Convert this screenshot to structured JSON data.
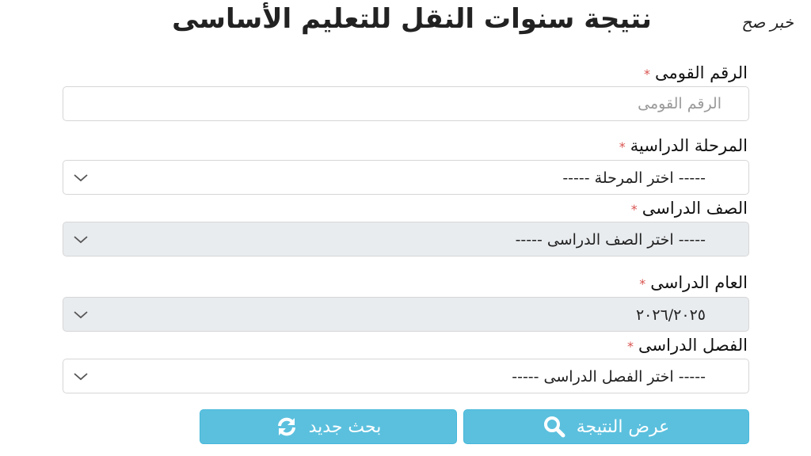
{
  "watermark": "خبر صح",
  "title": "نتيجة سنوات النقل للتعليم الأساسى",
  "required_mark": "*",
  "fields": {
    "national_id": {
      "label": "الرقم القومى",
      "placeholder": "الرقم القومى",
      "value": ""
    },
    "stage": {
      "label": "المرحلة الدراسية",
      "value": "----- اختر المرحلة -----"
    },
    "grade": {
      "label": "الصف الدراسى",
      "value": "----- اختر الصف الدراسى -----"
    },
    "year": {
      "label": "العام الدراسى",
      "value": "٢٠٢٦/٢٠٢٥"
    },
    "term": {
      "label": "الفصل الدراسى",
      "value": "----- اختر الفصل الدراسى -----"
    }
  },
  "buttons": {
    "show_result": "عرض النتيجة",
    "new_search": "بحث جديد"
  },
  "colors": {
    "button": "#5bc0de",
    "required": "#d9534f",
    "disabled_bg": "#e9ecef"
  },
  "icons": {
    "show_result": "search-icon",
    "new_search": "refresh-icon",
    "dropdown": "chevron-down-icon"
  }
}
